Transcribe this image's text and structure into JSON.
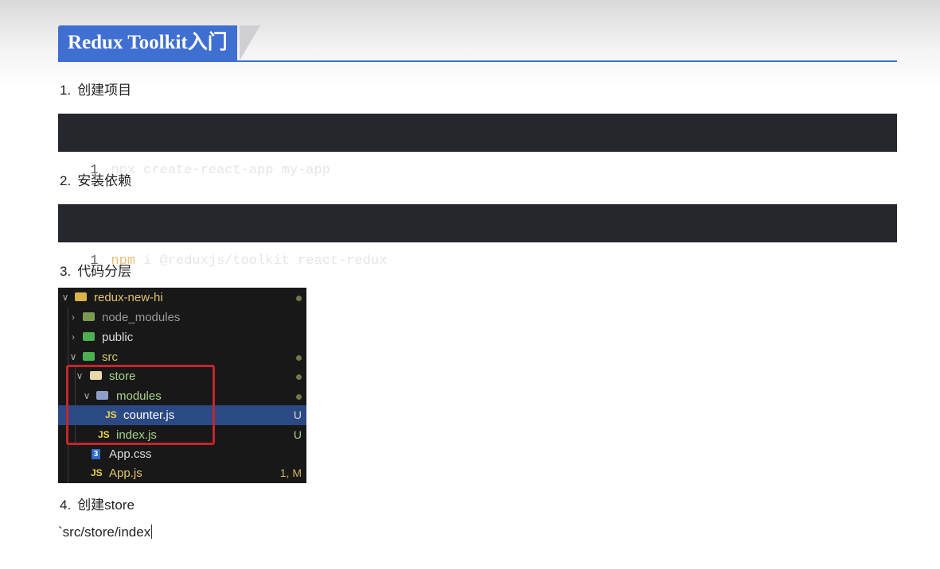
{
  "title": "Redux Toolkit入门",
  "steps": [
    {
      "num": "1.",
      "label": "创建项目"
    },
    {
      "num": "2.",
      "label": "安装依赖"
    },
    {
      "num": "3.",
      "label": "代码分层"
    },
    {
      "num": "4.",
      "label": "创建store"
    }
  ],
  "code1": {
    "line": "1",
    "text": "npx create-react-app my-app"
  },
  "code2": {
    "line": "1",
    "keyword": "npm",
    "rest": " i @reduxjs/toolkit react-redux"
  },
  "explorer": {
    "root": "redux-new-hi",
    "node_modules": "node_modules",
    "public": "public",
    "src": "src",
    "store": "store",
    "modules": "modules",
    "counter": {
      "name": "counter.js",
      "badge": "U",
      "icon": "JS"
    },
    "index": {
      "name": "index.js",
      "badge": "U",
      "icon": "JS"
    },
    "app_css": {
      "name": "App.css",
      "icon": "3"
    },
    "app_js": {
      "name": "App.js",
      "badge": "1, M",
      "icon": "JS"
    }
  },
  "path_text": "`src/store/index",
  "colors": {
    "accent": "#3e6fd1",
    "code_bg": "#25272c",
    "explorer_bg": "#181818",
    "highlight": "#c2262c"
  }
}
